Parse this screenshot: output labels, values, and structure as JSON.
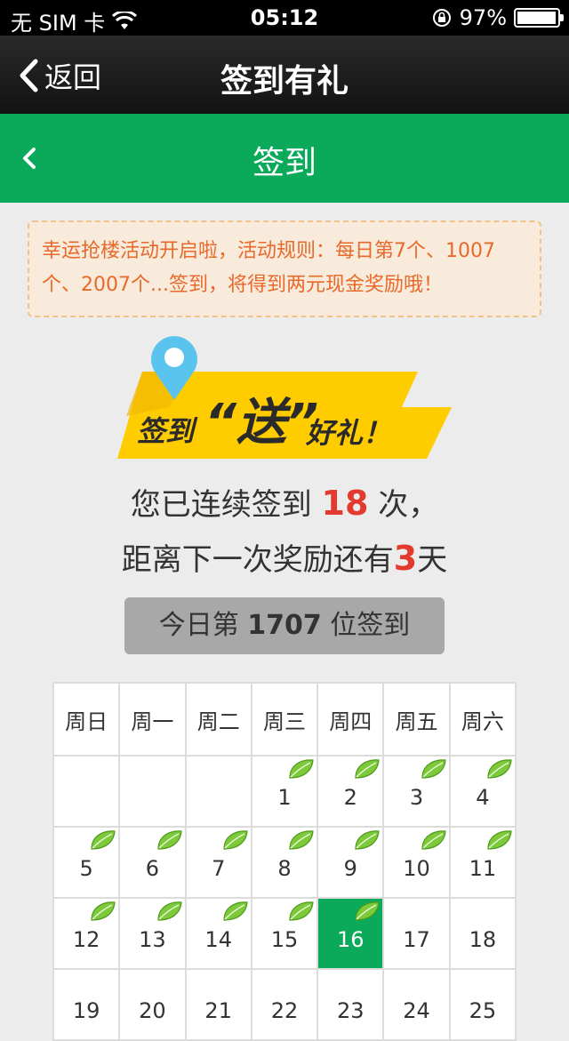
{
  "status_bar": {
    "carrier": "无 SIM 卡",
    "time": "05:12",
    "battery": "97%",
    "battery_level": 0.97
  },
  "nav": {
    "back_label": "返回",
    "title": "签到有礼"
  },
  "header": {
    "title": "签到"
  },
  "notice": {
    "text": "幸运抢楼活动开启啦，活动规则：每日第7个、1007个、2007个...签到，将得到两元现金奖励哦！"
  },
  "banner": {
    "part1": "签到",
    "part2": "“送”",
    "part3": "好礼！"
  },
  "streak": {
    "line1_prefix": "您已连续签到 ",
    "count": "18",
    "line1_suffix": " 次，",
    "line2_prefix": "距离下一次奖励还有",
    "days_left": "3",
    "line2_suffix": "天"
  },
  "today": {
    "prefix": "今日第 ",
    "rank": "1707",
    "suffix": " 位签到"
  },
  "calendar": {
    "weekdays": [
      "周日",
      "周一",
      "周二",
      "周三",
      "周四",
      "周五",
      "周六"
    ],
    "weeks": [
      [
        {
          "day": ""
        },
        {
          "day": ""
        },
        {
          "day": ""
        },
        {
          "day": "1",
          "checked": true
        },
        {
          "day": "2",
          "checked": true
        },
        {
          "day": "3",
          "checked": true
        },
        {
          "day": "4",
          "checked": true
        }
      ],
      [
        {
          "day": "5",
          "checked": true
        },
        {
          "day": "6",
          "checked": true
        },
        {
          "day": "7",
          "checked": true
        },
        {
          "day": "8",
          "checked": true
        },
        {
          "day": "9",
          "checked": true
        },
        {
          "day": "10",
          "checked": true
        },
        {
          "day": "11",
          "checked": true
        }
      ],
      [
        {
          "day": "12",
          "checked": true
        },
        {
          "day": "13",
          "checked": true
        },
        {
          "day": "14",
          "checked": true
        },
        {
          "day": "15",
          "checked": true
        },
        {
          "day": "16",
          "checked": true,
          "today": true
        },
        {
          "day": "17"
        },
        {
          "day": "18"
        }
      ],
      [
        {
          "day": "19"
        },
        {
          "day": "20"
        },
        {
          "day": "21"
        },
        {
          "day": "22"
        },
        {
          "day": "23"
        },
        {
          "day": "24"
        },
        {
          "day": "25"
        }
      ]
    ]
  },
  "colors": {
    "accent_green": "#0aaa5a",
    "highlight_red": "#e23a2e",
    "notice_orange": "#e8692a",
    "banner_yellow": "#ffcc00"
  }
}
